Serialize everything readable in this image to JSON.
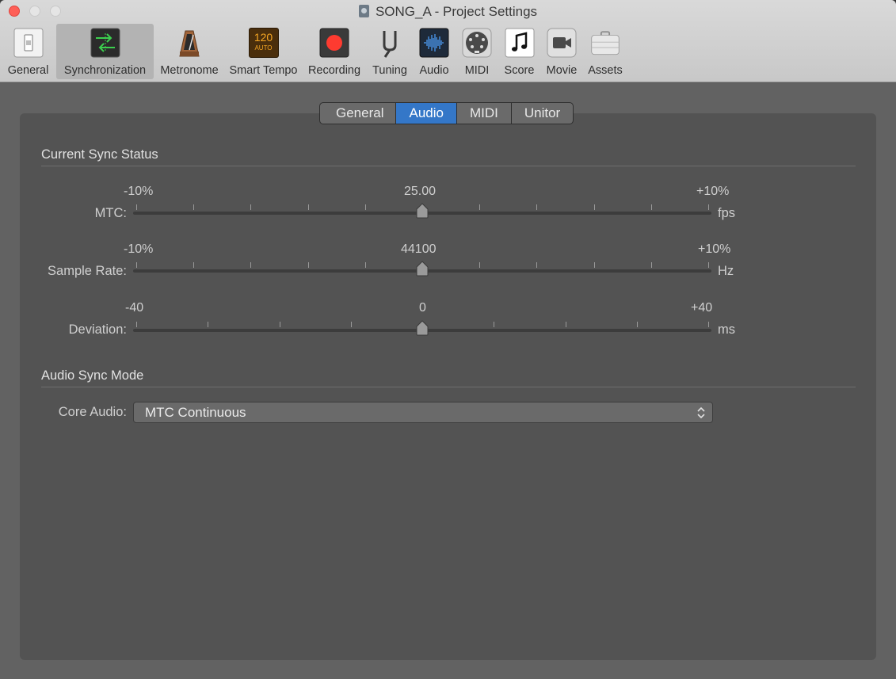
{
  "window": {
    "title": "SONG_A - Project Settings"
  },
  "toolbar": {
    "items": [
      {
        "label": "General",
        "icon": "general-switch-icon"
      },
      {
        "label": "Synchronization",
        "icon": "sync-arrows-icon",
        "active": true
      },
      {
        "label": "Metronome",
        "icon": "metronome-icon"
      },
      {
        "label": "Smart Tempo",
        "icon": "smart-tempo-icon",
        "badge_top": "120",
        "badge_bottom": "AUTO"
      },
      {
        "label": "Recording",
        "icon": "record-icon"
      },
      {
        "label": "Tuning",
        "icon": "tuning-fork-icon"
      },
      {
        "label": "Audio",
        "icon": "waveform-icon"
      },
      {
        "label": "MIDI",
        "icon": "midi-port-icon"
      },
      {
        "label": "Score",
        "icon": "music-note-icon"
      },
      {
        "label": "Movie",
        "icon": "video-camera-icon"
      },
      {
        "label": "Assets",
        "icon": "briefcase-icon"
      }
    ]
  },
  "tabs": [
    {
      "label": "General",
      "selected": false
    },
    {
      "label": "Audio",
      "selected": true
    },
    {
      "label": "MIDI",
      "selected": false
    },
    {
      "label": "Unitor",
      "selected": false
    }
  ],
  "sync_status": {
    "title": "Current Sync Status",
    "mtc": {
      "label": "MTC:",
      "min": "-10%",
      "max": "+10%",
      "value": "25.00",
      "unit": "fps",
      "position": 0.5
    },
    "sample_rate": {
      "label": "Sample Rate:",
      "min": "-10%",
      "max": "+10%",
      "value": "44100",
      "unit": "Hz",
      "position": 0.5
    },
    "deviation": {
      "label": "Deviation:",
      "min": "-40",
      "max": "+40",
      "value": "0",
      "unit": "ms",
      "position": 0.5
    }
  },
  "audio_sync_mode": {
    "title": "Audio Sync Mode",
    "core_audio": {
      "label": "Core Audio:",
      "value": "MTC Continuous"
    }
  },
  "colors": {
    "accent": "#3477c8",
    "record": "#fe3b30",
    "sync_green": "#3ccf4e"
  }
}
